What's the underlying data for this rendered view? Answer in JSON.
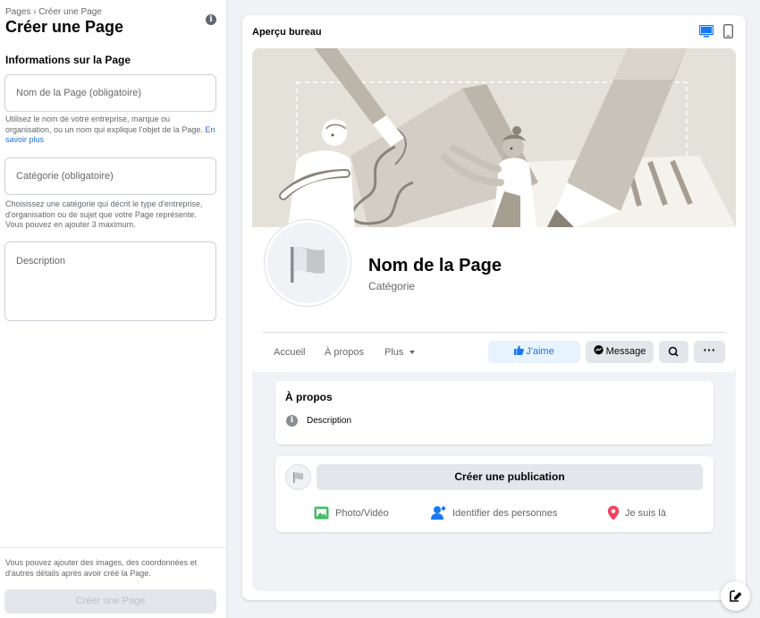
{
  "sidebar": {
    "breadcrumb": "Pages › Créer une Page",
    "title": "Créer une Page",
    "section_title": "Informations sur la Page",
    "name_placeholder": "Nom de la Page (obligatoire)",
    "name_help": "Utilisez le nom de votre entreprise, marque ou organisation, ou un nom qui explique l'objet de la Page.",
    "learn_more": "En savoir plus",
    "category_placeholder": "Catégorie (obligatoire)",
    "category_help": "Choisissez une catégorie qui décrit le type d'entreprise, d'organisation ou de sujet que votre Page représente. Vous pouvez en ajouter 3 maximum.",
    "description_placeholder": "Description",
    "footer_text": "Vous pouvez ajouter des images, des coordonnées et d'autres détails après avoir créé la Page.",
    "create_button": "Créer une Page"
  },
  "preview": {
    "title": "Aperçu bureau",
    "page_name": "Nom de la Page",
    "page_category": "Catégorie",
    "nav": {
      "home": "Accueil",
      "about": "À propos",
      "more": "Plus"
    },
    "like_button": "J'aime",
    "message_button": "Message",
    "more_button": "···",
    "about_card": {
      "title": "À propos",
      "description": "Description"
    },
    "post_card": {
      "create_post": "Créer une publication",
      "photo_video": "Photo/Vidéo",
      "tag_people": "Identifier des personnes",
      "check_in": "Je suis là"
    }
  },
  "colors": {
    "accent": "#1877f2",
    "like_bg": "#e7f3ff",
    "button_grey": "#e4e6eb",
    "photo_green": "#45bd62",
    "location_red": "#f3425f"
  }
}
